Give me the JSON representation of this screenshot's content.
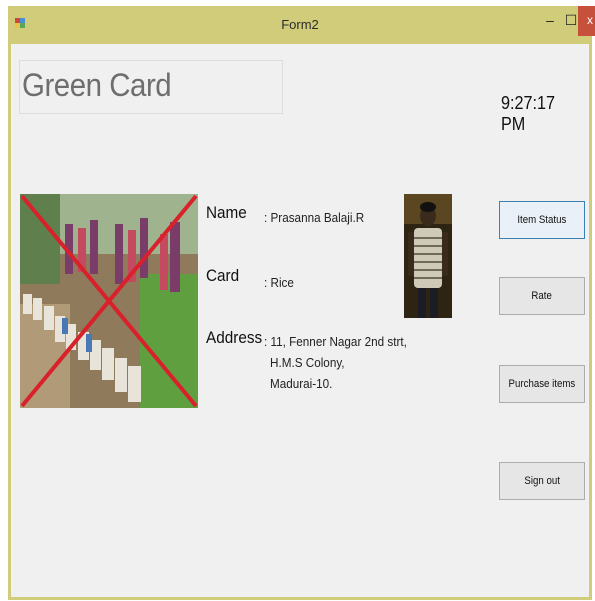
{
  "window": {
    "title": "Form2"
  },
  "controls": {
    "minimize": "–",
    "maximize": "☐",
    "close": "x"
  },
  "header": {
    "title": "Green Card"
  },
  "clock": {
    "time": "9:27:17 PM"
  },
  "details": {
    "name_label": "Name",
    "name_value": ": Prasanna Balaji.R",
    "card_label": "Card",
    "card_value": ": Rice",
    "address_label": "Address",
    "address_lines": [
      ": 11, Fenner Nagar 2nd strt,",
      "H.M.S Colony,",
      "Madurai-10."
    ]
  },
  "buttons": {
    "item_status": "Item Status",
    "rate": "Rate",
    "purchase_items": "Purchase items",
    "sign_out": "Sign out"
  },
  "colors": {
    "frame": "#d0cc7a",
    "close": "#c7503a",
    "cross": "#d8212b",
    "client": "#f0f0f0"
  },
  "icons": {
    "app": "app-icon",
    "cross": "red-cross-overlay"
  }
}
